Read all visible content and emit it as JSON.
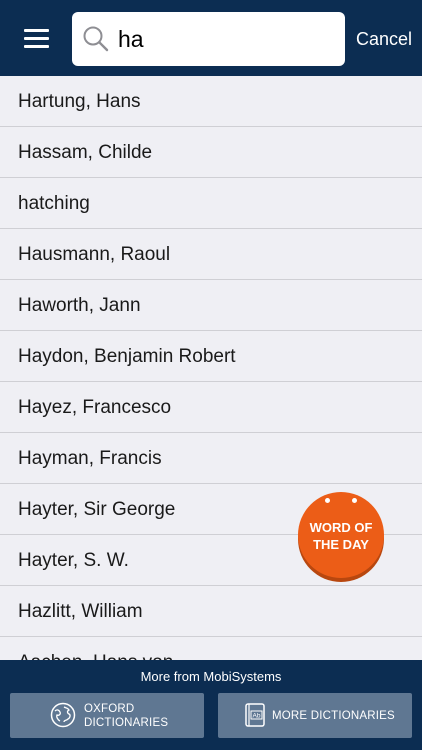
{
  "header": {
    "menu_icon": "hamburger-menu-icon",
    "search": {
      "value": "ha",
      "icon": "search-icon"
    },
    "cancel_label": "Cancel"
  },
  "results": [
    "Hartung, Hans",
    "Hassam, Childe",
    "hatching",
    "Hausmann, Raoul",
    "Haworth, Jann",
    "Haydon, Benjamin Robert",
    "Hayez, Francesco",
    "Hayman, Francis",
    "Hayter, Sir George",
    "Hayter, S. W.",
    "Hazlitt, William",
    "Aachen, Hans von"
  ],
  "word_of_the_day": {
    "line1": "WORD OF",
    "line2": "THE DAY",
    "color": "#ec5d17"
  },
  "footer": {
    "title": "More from MobiSystems",
    "buttons": [
      {
        "line1": "OXFORD",
        "line2": "DICTIONARIES",
        "icon": "globe-icon"
      },
      {
        "label": "MORE DICTIONARIES",
        "icon": "dictionary-book-icon"
      }
    ]
  },
  "colors": {
    "header_bg": "#0c2d52",
    "list_bg": "#efeff4",
    "footer_button_bg": "#5f7792"
  }
}
